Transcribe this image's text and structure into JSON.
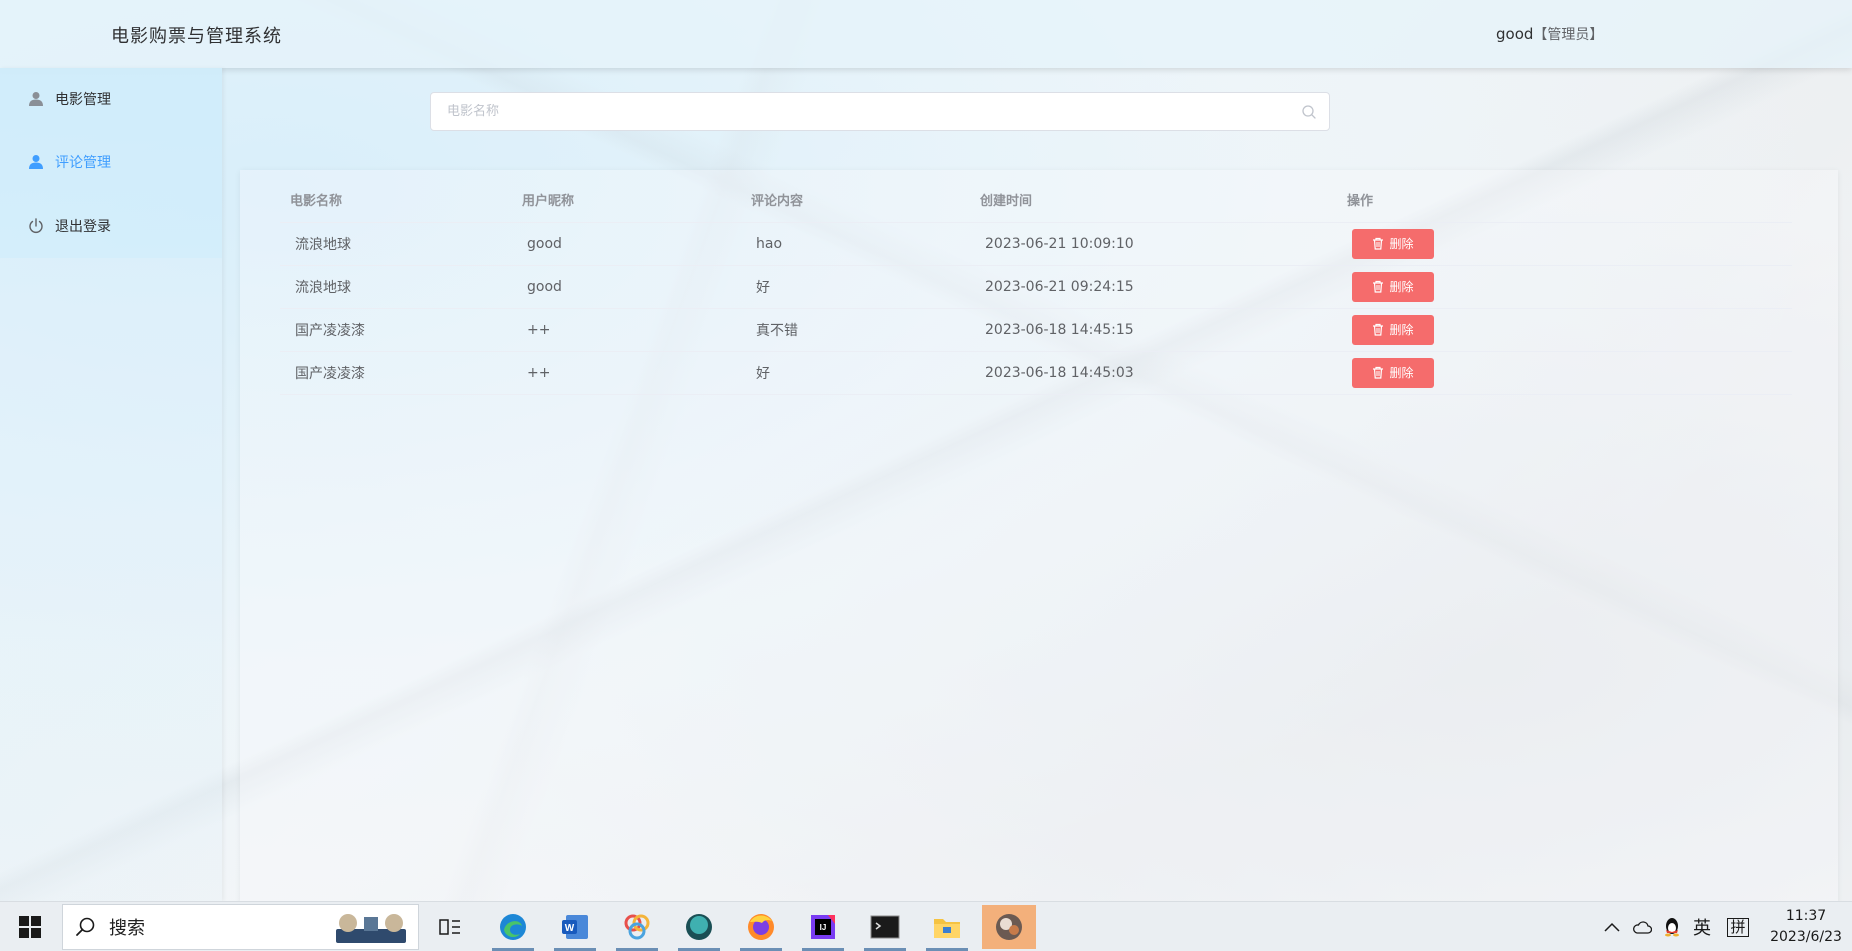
{
  "app": {
    "title": "电影购票与管理系统"
  },
  "header": {
    "username": "good",
    "role": "【管理员】"
  },
  "sidebar": {
    "items": [
      {
        "label": "电影管理",
        "icon": "user-icon",
        "active": false
      },
      {
        "label": "评论管理",
        "icon": "user-icon",
        "active": true
      },
      {
        "label": "退出登录",
        "icon": "power-icon",
        "active": false
      }
    ]
  },
  "search": {
    "placeholder": "电影名称",
    "value": ""
  },
  "table": {
    "headers": [
      "电影名称",
      "用户昵称",
      "评论内容",
      "创建时间",
      "操作"
    ],
    "rows": [
      {
        "movie": "流浪地球",
        "user": "good",
        "comment": "hao",
        "created": "2023-06-21 10:09:10",
        "action": "删除"
      },
      {
        "movie": "流浪地球",
        "user": "good",
        "comment": "好",
        "created": "2023-06-21 09:24:15",
        "action": "删除"
      },
      {
        "movie": "国产凌凌漆",
        "user": "++",
        "comment": "真不错",
        "created": "2023-06-18 14:45:15",
        "action": "删除"
      },
      {
        "movie": "国产凌凌漆",
        "user": "++",
        "comment": "好",
        "created": "2023-06-18 14:45:03",
        "action": "删除"
      }
    ]
  },
  "taskbar": {
    "search_label": "搜索",
    "apps": [
      "task-view",
      "edge",
      "word",
      "app-colorful",
      "app-teal",
      "firefox",
      "intellij",
      "terminal",
      "file-explorer",
      "app-active"
    ],
    "tray": {
      "ime_lang": "英",
      "ime_mode": "拼"
    },
    "time": "11:37",
    "date": "2023/6/23"
  },
  "colors": {
    "accent": "#409eff",
    "danger": "#f56c6c",
    "text_primary": "#303133",
    "text_regular": "#606266",
    "header_text": "#909399"
  }
}
